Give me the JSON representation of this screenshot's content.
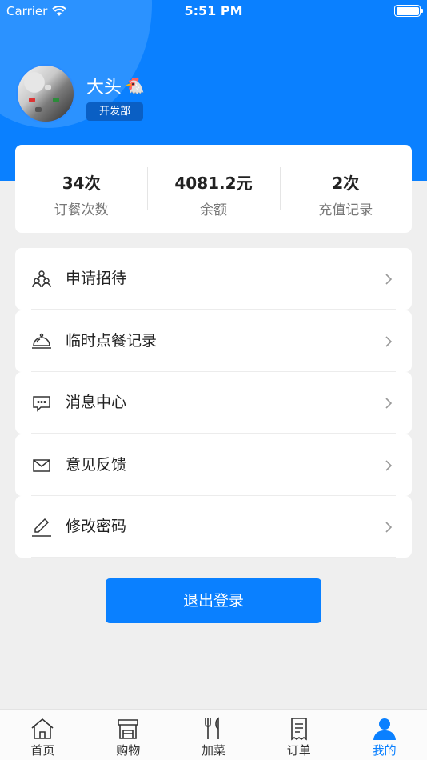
{
  "status_bar": {
    "carrier": "Carrier",
    "time": "5:51 PM"
  },
  "profile": {
    "name": "大头",
    "emoji": "🐔",
    "department": "开发部"
  },
  "stats": [
    {
      "value": "34次",
      "label": "订餐次数"
    },
    {
      "value": "4081.2元",
      "label": "余额"
    },
    {
      "value": "2次",
      "label": "充值记录"
    }
  ],
  "menu": [
    {
      "label": "申请招待",
      "icon": "people-icon"
    },
    {
      "label": "临时点餐记录",
      "icon": "food-cloche-icon"
    },
    {
      "label": "消息中心",
      "icon": "message-icon"
    },
    {
      "label": "意见反馈",
      "icon": "envelope-icon"
    },
    {
      "label": "修改密码",
      "icon": "pencil-icon"
    }
  ],
  "logout_label": "退出登录",
  "tabs": [
    {
      "label": "首页",
      "icon": "home-icon"
    },
    {
      "label": "购物",
      "icon": "store-icon"
    },
    {
      "label": "加菜",
      "icon": "utensils-icon"
    },
    {
      "label": "订单",
      "icon": "receipt-icon"
    },
    {
      "label": "我的",
      "icon": "person-icon",
      "active": true
    }
  ],
  "colors": {
    "primary": "#0a80ff",
    "background": "#efefef"
  }
}
